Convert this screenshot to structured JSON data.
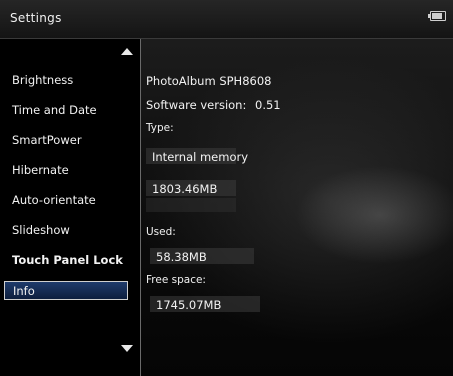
{
  "header": {
    "title": "Settings",
    "battery_icon": "battery-icon"
  },
  "sidebar": {
    "items": [
      {
        "label": "Brightness"
      },
      {
        "label": "Time and Date"
      },
      {
        "label": "SmartPower"
      },
      {
        "label": "Hibernate"
      },
      {
        "label": "Auto-orientate"
      },
      {
        "label": "Slideshow"
      },
      {
        "label": "Touch Panel Lock"
      },
      {
        "label": "Info",
        "selected": true
      }
    ],
    "scroll_up_icon": "triangle-up-icon",
    "scroll_down_icon": "triangle-down-icon"
  },
  "info": {
    "model": "PhotoAlbum  SPH8608",
    "software_version_label": "Software version:",
    "software_version": "0.51",
    "type_label": "Type:",
    "memory_type": "Internal memory",
    "total": "1803.46MB",
    "used_label": "Used:",
    "used": "58.38MB",
    "free_label": "Free space:",
    "free": "1745.07MB"
  },
  "colors": {
    "selected_bg": "#1f3b6b",
    "text": "#f2f2f2"
  }
}
